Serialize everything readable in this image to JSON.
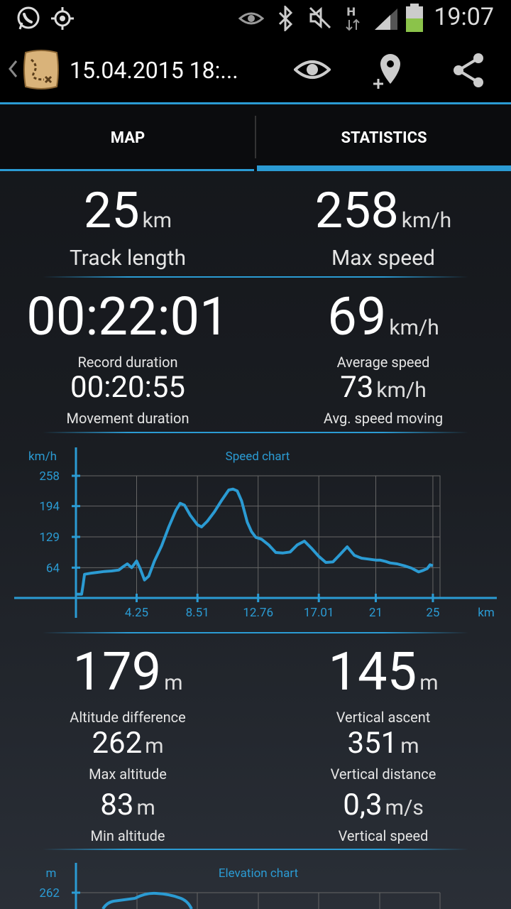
{
  "status_bar": {
    "time": "19:07",
    "network": "H"
  },
  "action_bar": {
    "title": "15.04.2015 18:...",
    "icons": [
      "back-chevron-icon",
      "treasure-map-icon",
      "eye-icon",
      "add-location-icon",
      "share-icon"
    ]
  },
  "tabs": [
    {
      "label": "MAP",
      "selected": false
    },
    {
      "label": "STATISTICS",
      "selected": true
    }
  ],
  "stats": {
    "track_length": {
      "value": "25",
      "unit": "km",
      "label": "Track length"
    },
    "max_speed": {
      "value": "258",
      "unit": "km/h",
      "label": "Max speed"
    },
    "record_duration": {
      "value": "00:22:01",
      "label": "Record duration"
    },
    "average_speed": {
      "value": "69",
      "unit": "km/h",
      "label": "Average speed"
    },
    "movement_duration": {
      "value": "00:20:55",
      "label": "Movement duration"
    },
    "avg_speed_moving": {
      "value": "73",
      "unit": "km/h",
      "label": "Avg. speed moving"
    },
    "altitude_difference": {
      "value": "179",
      "unit": "m",
      "label": "Altitude difference"
    },
    "vertical_ascent": {
      "value": "145",
      "unit": "m",
      "label": "Vertical ascent"
    },
    "max_altitude": {
      "value": "262",
      "unit": "m",
      "label": "Max altitude"
    },
    "vertical_distance": {
      "value": "351",
      "unit": "m",
      "label": "Vertical distance"
    },
    "min_altitude": {
      "value": "83",
      "unit": "m",
      "label": "Min altitude"
    },
    "vertical_speed": {
      "value": "0,3",
      "unit": "m/s",
      "label": "Vertical speed"
    }
  },
  "chart_data": [
    {
      "type": "line",
      "title": "Speed chart",
      "ylabel": "km/h",
      "xlabel": "km",
      "y_ticks": [
        "258",
        "194",
        "129",
        "64"
      ],
      "x_ticks": [
        "4.25",
        "8.51",
        "12.76",
        "17.01",
        "21",
        "25"
      ],
      "xlim": [
        0,
        25.5
      ],
      "ylim": [
        0,
        258
      ],
      "grid": true,
      "color": "#2b9bd3",
      "series": [
        {
          "x": [
            0,
            0.4,
            0.5,
            0.6,
            1,
            1.5,
            2,
            2.5,
            3,
            3.3,
            3.6,
            3.9,
            4.25,
            4.5,
            4.8,
            5.1,
            5.5,
            6,
            6.5,
            7,
            7.3,
            7.6,
            8,
            8.5,
            8.8,
            9.2,
            9.7,
            10.2,
            10.7,
            11,
            11.3,
            11.6,
            12,
            12.3,
            12.6,
            13,
            13.5,
            14,
            14.5,
            15,
            15.5,
            16,
            16.5,
            17,
            17.5,
            18,
            18.5,
            19,
            19.5,
            20,
            20.5,
            21,
            21.3,
            21.7,
            22,
            22.5,
            23,
            23.5,
            24,
            24.3,
            24.6,
            24.8,
            25
          ],
          "y": [
            8,
            8,
            28,
            50,
            52,
            54,
            56,
            57,
            59,
            66,
            72,
            64,
            78,
            62,
            38,
            46,
            78,
            110,
            150,
            185,
            200,
            196,
            175,
            155,
            150,
            162,
            182,
            206,
            228,
            230,
            226,
            205,
            160,
            140,
            128,
            124,
            112,
            96,
            95,
            97,
            112,
            120,
            105,
            88,
            75,
            76,
            92,
            108,
            90,
            84,
            82,
            80,
            80,
            77,
            74,
            72,
            68,
            63,
            55,
            58,
            62,
            70,
            68
          ]
        }
      ]
    },
    {
      "type": "line",
      "title": "Elevation chart",
      "ylabel": "m",
      "y_ticks": [
        "262"
      ],
      "color": "#2b9bd3"
    }
  ]
}
